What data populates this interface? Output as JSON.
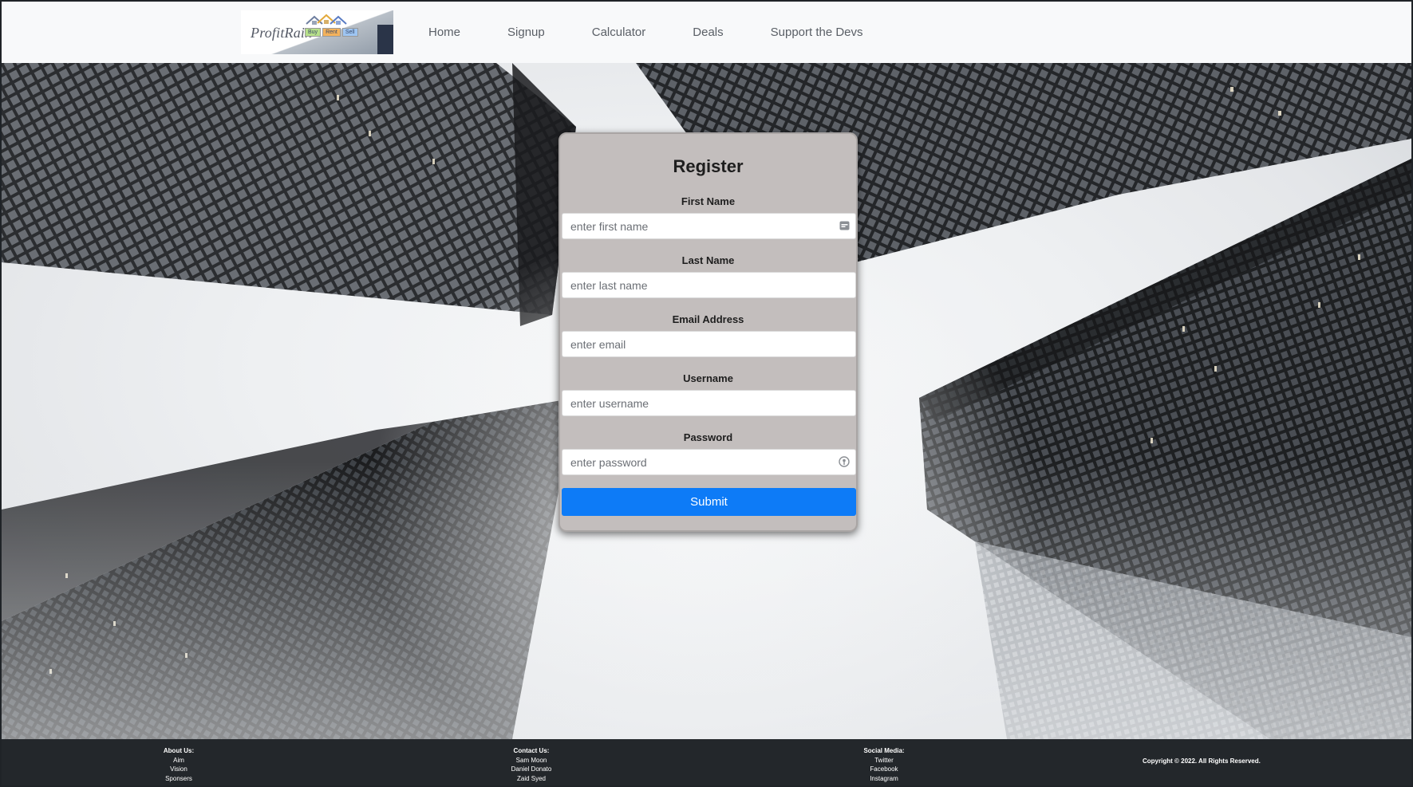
{
  "brand": {
    "logo_text": "ProfitRain",
    "logo_tags": [
      "Buy",
      "Rent",
      "Sell"
    ]
  },
  "nav": {
    "items": [
      {
        "label": "Home"
      },
      {
        "label": "Signup"
      },
      {
        "label": "Calculator"
      },
      {
        "label": "Deals"
      },
      {
        "label": "Support the Devs"
      }
    ]
  },
  "form": {
    "title": "Register",
    "fields": [
      {
        "label": "First Name",
        "placeholder": "enter first name",
        "value": ""
      },
      {
        "label": "Last Name",
        "placeholder": "enter last name",
        "value": ""
      },
      {
        "label": "Email Address",
        "placeholder": "enter email",
        "value": ""
      },
      {
        "label": "Username",
        "placeholder": "enter username",
        "value": ""
      },
      {
        "label": "Password",
        "placeholder": "enter password",
        "value": ""
      }
    ],
    "submit_label": "Submit",
    "colors": {
      "card": "#c3bebd",
      "submit": "#0d7bf7"
    }
  },
  "footer": {
    "about": {
      "heading": "About Us:",
      "items": [
        "Aim",
        "Vision",
        "Sponsers"
      ]
    },
    "contact": {
      "heading": "Contact Us:",
      "items": [
        "Sam Moon",
        "Daniel Donato",
        "Zaid Syed"
      ]
    },
    "social": {
      "heading": "Social Media:",
      "items": [
        "Twitter",
        "Facebook",
        "Instagram"
      ]
    },
    "copyright": "Copyright © 2022. All Rights Reserved."
  }
}
